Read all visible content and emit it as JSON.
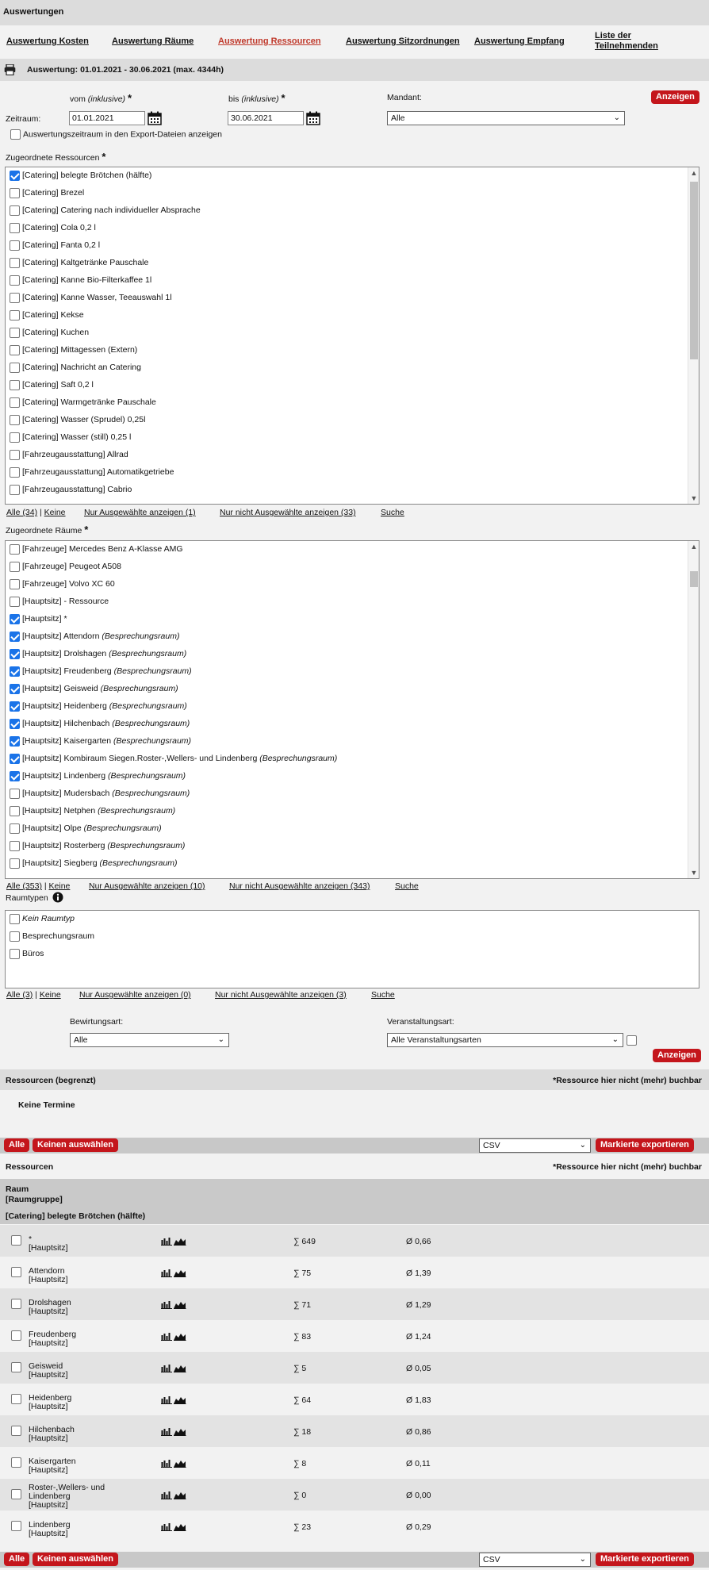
{
  "header": {
    "title": "Auswertungen"
  },
  "nav": {
    "tabs": [
      {
        "label": "Auswertung Kosten"
      },
      {
        "label": "Auswertung Räume"
      },
      {
        "label": "Auswertung Ressourcen"
      },
      {
        "label": "Auswertung Sitzordnungen"
      },
      {
        "label": "Auswertung Empfang"
      },
      {
        "label_line1": "Liste der",
        "label_line2": "Teilnehmenden"
      }
    ]
  },
  "report": {
    "period_title": "Auswertung: 01.01.2021 - 30.06.2021 (max. 4344h)"
  },
  "form": {
    "from_label": "vom",
    "from_note": "(inklusive)",
    "to_label": "bis",
    "to_note": "(inklusive)",
    "required_marker": "*",
    "period_label": "Zeitraum:",
    "from_value": "01.01.2021",
    "to_value": "30.06.2021",
    "tenant_label": "Mandant:",
    "tenant_value": "Alle",
    "show_button": "Anzeigen",
    "export_period_label": "Auswertungszeitraum in den Export-Dateien anzeigen",
    "resources_label": "Zugeordnete Ressourcen",
    "rooms_label": "Zugeordnete Räume",
    "roomtypes_label": "Raumtypen",
    "catering_label": "Bewirtungsart:",
    "catering_value": "Alle",
    "eventtype_label": "Veranstaltungsart:",
    "eventtype_value": "Alle Veranstaltungsarten"
  },
  "resources_list": [
    {
      "label": "[Catering] belegte Brötchen (hälfte)",
      "checked": true
    },
    {
      "label": "[Catering] Brezel",
      "checked": false
    },
    {
      "label": "[Catering] Catering nach individueller Absprache",
      "checked": false
    },
    {
      "label": "[Catering] Cola 0,2 l",
      "checked": false
    },
    {
      "label": "[Catering] Fanta 0,2 l",
      "checked": false
    },
    {
      "label": "[Catering] Kaltgetränke Pauschale",
      "checked": false
    },
    {
      "label": "[Catering] Kanne Bio-Filterkaffee 1l",
      "checked": false
    },
    {
      "label": "[Catering] Kanne Wasser, Teeauswahl 1l",
      "checked": false
    },
    {
      "label": "[Catering] Kekse",
      "checked": false
    },
    {
      "label": "[Catering] Kuchen",
      "checked": false
    },
    {
      "label": "[Catering] Mittagessen (Extern)",
      "checked": false
    },
    {
      "label": "[Catering] Nachricht an Catering",
      "checked": false
    },
    {
      "label": "[Catering] Saft 0,2 l",
      "checked": false
    },
    {
      "label": "[Catering] Warmgetränke Pauschale",
      "checked": false
    },
    {
      "label": "[Catering] Wasser (Sprudel) 0,25l",
      "checked": false
    },
    {
      "label": "[Catering] Wasser (still) 0,25 l",
      "checked": false
    },
    {
      "label": "[Fahrzeugausstattung] Allrad",
      "checked": false
    },
    {
      "label": "[Fahrzeugausstattung] Automatikgetriebe",
      "checked": false
    },
    {
      "label": "[Fahrzeugausstattung] Cabrio",
      "checked": false
    }
  ],
  "resources_filter": {
    "all": "Alle (34)",
    "none": "Keine",
    "selected": "Nur Ausgewählte anzeigen (1)",
    "unselected": "Nur nicht Ausgewählte anzeigen (33)",
    "search": "Suche"
  },
  "rooms_list": [
    {
      "label": "[Fahrzeuge] Mercedes Benz A-Klasse AMG",
      "type": "",
      "checked": false
    },
    {
      "label": "[Fahrzeuge] Peugeot A508",
      "type": "",
      "checked": false
    },
    {
      "label": "[Fahrzeuge] Volvo XC 60",
      "type": "",
      "checked": false
    },
    {
      "label": "[Hauptsitz] - Ressource",
      "type": "",
      "checked": false
    },
    {
      "label": "[Hauptsitz] *",
      "type": "",
      "checked": true
    },
    {
      "label": "[Hauptsitz] Attendorn",
      "type": "(Besprechungsraum)",
      "checked": true
    },
    {
      "label": "[Hauptsitz] Drolshagen",
      "type": "(Besprechungsraum)",
      "checked": true
    },
    {
      "label": "[Hauptsitz] Freudenberg",
      "type": "(Besprechungsraum)",
      "checked": true
    },
    {
      "label": "[Hauptsitz] Geisweid",
      "type": "(Besprechungsraum)",
      "checked": true
    },
    {
      "label": "[Hauptsitz] Heidenberg",
      "type": "(Besprechungsraum)",
      "checked": true
    },
    {
      "label": "[Hauptsitz] Hilchenbach",
      "type": "(Besprechungsraum)",
      "checked": true
    },
    {
      "label": "[Hauptsitz] Kaisergarten",
      "type": "(Besprechungsraum)",
      "checked": true
    },
    {
      "label": "[Hauptsitz] Kombiraum Siegen.Roster-,Wellers- und Lindenberg",
      "type": "(Besprechungsraum)",
      "checked": true
    },
    {
      "label": "[Hauptsitz] Lindenberg",
      "type": "(Besprechungsraum)",
      "checked": true
    },
    {
      "label": "[Hauptsitz] Mudersbach",
      "type": "(Besprechungsraum)",
      "checked": false
    },
    {
      "label": "[Hauptsitz] Netphen",
      "type": "(Besprechungsraum)",
      "checked": false
    },
    {
      "label": "[Hauptsitz] Olpe",
      "type": "(Besprechungsraum)",
      "checked": false
    },
    {
      "label": "[Hauptsitz] Rosterberg",
      "type": "(Besprechungsraum)",
      "checked": false
    },
    {
      "label": "[Hauptsitz] Siegberg",
      "type": "(Besprechungsraum)",
      "checked": false
    }
  ],
  "rooms_filter": {
    "all": "Alle (353)",
    "none": "Keine",
    "selected": "Nur Ausgewählte anzeigen (10)",
    "unselected": "Nur nicht Ausgewählte anzeigen (343)",
    "search": "Suche"
  },
  "roomtypes_list": [
    {
      "label": "Kein Raumtyp",
      "italic": true
    },
    {
      "label": "Besprechungsraum",
      "italic": false
    },
    {
      "label": "Büros",
      "italic": false
    }
  ],
  "roomtypes_filter": {
    "all": "Alle (3)",
    "none": "Keine",
    "selected": "Nur Ausgewählte anzeigen (0)",
    "unselected": "Nur nicht Ausgewählte anzeigen (3)",
    "search": "Suche"
  },
  "section_limited": {
    "title": "Ressourcen (begrenzt)",
    "note": "*Ressource hier nicht (mehr) buchbar",
    "empty": "Keine Termine"
  },
  "actions": {
    "all": "Alle",
    "none": "Keinen auswählen",
    "format": "CSV",
    "export": "Markierte exportieren"
  },
  "section_resources": {
    "title": "Ressourcen",
    "note": "*Ressource hier nicht (mehr) buchbar"
  },
  "table": {
    "col_room": "Raum",
    "col_group": "[Raumgruppe]",
    "group_title": "[Catering] belegte Brötchen (hälfte)",
    "rows": [
      {
        "name": "*",
        "group": "[Hauptsitz]",
        "sum": "∑ 649",
        "avg": "Ø 0,66"
      },
      {
        "name": "Attendorn",
        "group": "[Hauptsitz]",
        "sum": "∑ 75",
        "avg": "Ø 1,39"
      },
      {
        "name": "Drolshagen",
        "group": "[Hauptsitz]",
        "sum": "∑ 71",
        "avg": "Ø 1,29"
      },
      {
        "name": "Freudenberg",
        "group": "[Hauptsitz]",
        "sum": "∑ 83",
        "avg": "Ø 1,24"
      },
      {
        "name": "Geisweid",
        "group": "[Hauptsitz]",
        "sum": "∑ 5",
        "avg": "Ø 0,05"
      },
      {
        "name": "Heidenberg",
        "group": "[Hauptsitz]",
        "sum": "∑ 64",
        "avg": "Ø 1,83"
      },
      {
        "name": "Hilchenbach",
        "group": "[Hauptsitz]",
        "sum": "∑ 18",
        "avg": "Ø 0,86"
      },
      {
        "name": "Kaisergarten",
        "group": "[Hauptsitz]",
        "sum": "∑ 8",
        "avg": "Ø 0,11"
      },
      {
        "name": "Roster-,Wellers- und Lindenberg",
        "group": "[Hauptsitz]",
        "sum": "∑ 0",
        "avg": "Ø 0,00"
      },
      {
        "name": "Lindenberg",
        "group": "[Hauptsitz]",
        "sum": "∑ 23",
        "avg": "Ø 0,29"
      }
    ]
  }
}
